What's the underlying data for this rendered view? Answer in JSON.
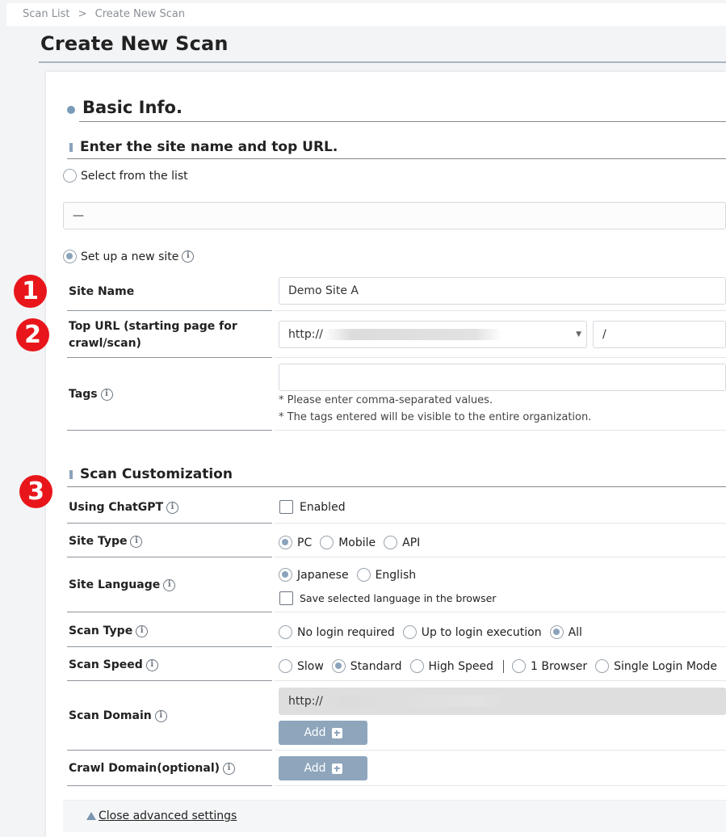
{
  "breadcrumb": {
    "items": [
      "Scan List",
      "Create New Scan"
    ],
    "separator": ">"
  },
  "page": {
    "title": "Create New Scan"
  },
  "basic_info": {
    "heading": "Basic Info.",
    "subheading": "Enter the site name and top URL.",
    "select_from_list_label": "Select from the list",
    "site_select_value": "—",
    "new_site_label": "Set up a new site",
    "site_name": {
      "label": "Site Name",
      "value": "Demo Site A"
    },
    "top_url": {
      "label": "Top URL (starting page for crawl/scan)",
      "protocol": "http://",
      "path": "/"
    },
    "tags": {
      "label": "Tags",
      "value": "",
      "note1": "* Please enter comma-separated values.",
      "note2": "* The tags entered will be visible to the entire organization."
    }
  },
  "scan_customization": {
    "heading": "Scan Customization",
    "chatgpt": {
      "label": "Using ChatGPT",
      "option": "Enabled",
      "checked": false
    },
    "site_type": {
      "label": "Site Type",
      "options": [
        "PC",
        "Mobile",
        "API"
      ],
      "selected": "PC"
    },
    "site_language": {
      "label": "Site Language",
      "options": [
        "Japanese",
        "English"
      ],
      "selected": "Japanese",
      "save_label": "Save selected language in the browser"
    },
    "scan_type": {
      "label": "Scan Type",
      "options": [
        "No login required",
        "Up to login execution",
        "All"
      ],
      "selected": "All"
    },
    "scan_speed": {
      "label": "Scan Speed",
      "options": [
        "Slow",
        "Standard",
        "High Speed"
      ],
      "selected": "Standard",
      "extra_options": [
        "1 Browser",
        "Single Login Mode"
      ]
    },
    "scan_domain": {
      "label": "Scan Domain",
      "value": "http://",
      "add_label": "Add"
    },
    "crawl_domain": {
      "label": "Crawl Domain(optional)",
      "add_label": "Add"
    }
  },
  "advanced": {
    "toggle_label": "Close advanced settings"
  },
  "badges": [
    "1",
    "2",
    "3"
  ],
  "colors": {
    "accent": "#8ea5bc",
    "badge": "#e8161b",
    "radio_on": "#8aa3bb"
  }
}
